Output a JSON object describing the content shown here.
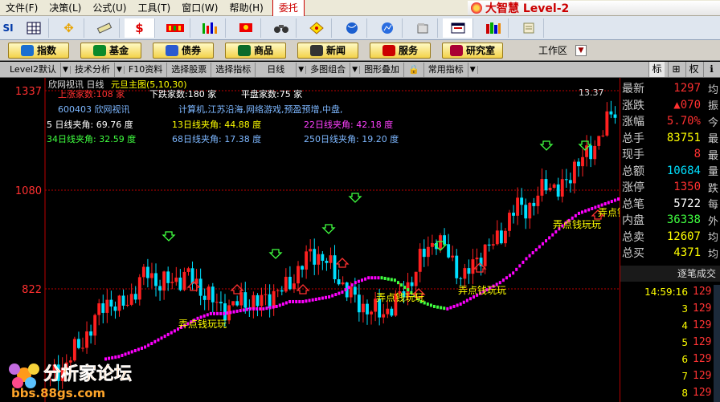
{
  "menu": {
    "items": [
      "文件(F)",
      "决策(L)",
      "公式(U)",
      "工具(T)",
      "窗口(W)",
      "帮助(H)"
    ],
    "weituo": "委托",
    "brand": "大智慧 Level-2"
  },
  "iconbar": {
    "icons": [
      "si-icon",
      "grid-icon",
      "move-icon",
      "ruler-icon",
      "dollar-icon",
      "stripes-icon",
      "bars-icon",
      "flag-icon",
      "binoculars-icon",
      "diamond-icon",
      "globe-icon",
      "chart-icon",
      "doc-icon",
      "window-icon",
      "books-icon",
      "scroll-icon"
    ]
  },
  "funcbar": {
    "buttons": [
      "指数",
      "基金",
      "债券",
      "商品",
      "新闻",
      "服务",
      "研究室"
    ],
    "workspace": "工作区"
  },
  "tabs": {
    "items": [
      "Level2默认",
      "技术分析",
      "F10资料",
      "选择股票",
      "选择指标",
      "日线",
      "多图组合",
      "图形叠加",
      "常用指标"
    ],
    "right": [
      "标",
      "⊞",
      "权",
      "ℹ"
    ]
  },
  "chart": {
    "title": "欣网视讯 日线",
    "subtitle": "元旦主图(5,10,30)",
    "up_text": "上涨家数:108 家",
    "down_text": "下跌家数:180 家",
    "flat_text": "平盘家数:75 家",
    "code_name": "600403 欣网视讯",
    "concepts": "计算机,江苏沿海,网络游戏,预盈预增,中盘,",
    "angle_lines": [
      [
        "5 日线夹角: 69.76 度",
        "13日线夹角: 44.88 度",
        "22日线夹角: 42.18 度"
      ],
      [
        "34日线夹角: 32.59 度",
        "68日线夹角: 17.38 度",
        "250日线夹角: 19.20 度"
      ]
    ],
    "high_label": "13.37",
    "y_labels": [
      "1337",
      "1080",
      "822"
    ],
    "annotations": [
      "弄点钱玩玩",
      "弄点钱玩玩",
      "弄点钱玩玩",
      "弄点钱玩玩",
      "弄点钱玩"
    ],
    "watermark": "分析家论坛",
    "watermark_url": "bbs.88gs.com",
    "colors": {
      "up": "#ff2020",
      "down": "#00e0ff",
      "ma_low": "#ff00ff",
      "ma_high": "#40ff40"
    }
  },
  "chart_data": {
    "type": "candlestick",
    "ylim": [
      700,
      1337
    ],
    "ma_levels": [
      775,
      780,
      790,
      800,
      815,
      830,
      845,
      860,
      870,
      870,
      875,
      880,
      880,
      885,
      895,
      895,
      900,
      905,
      915,
      935,
      945,
      945,
      940,
      920,
      895,
      885,
      880,
      890,
      905,
      920,
      935,
      955,
      985,
      1010,
      1035,
      1060,
      1080,
      1090,
      1100,
      1110
    ],
    "closes": [
      740,
      760,
      800,
      840,
      900,
      880,
      910,
      960,
      930,
      940,
      950,
      920,
      890,
      880,
      900,
      890,
      910,
      920,
      960,
      1000,
      980,
      940,
      900,
      880,
      870,
      890,
      930,
      990,
      1030,
      990,
      940,
      990,
      1010,
      1050,
      1100,
      1090,
      1150,
      1120,
      1180,
      1200,
      1250,
      1297
    ]
  },
  "quote": {
    "rows": [
      {
        "label": "最新",
        "value": "1297",
        "suffix": "均",
        "color": "#ff3030"
      },
      {
        "label": "涨跌",
        "value": "▲070",
        "suffix": "振",
        "color": "#ff3030"
      },
      {
        "label": "涨幅",
        "value": "5.70%",
        "suffix": "今",
        "color": "#ff3030"
      },
      {
        "label": "总手",
        "value": "83751",
        "suffix": "最",
        "color": "#ffff00"
      },
      {
        "label": "现手",
        "value": "8",
        "suffix": "最",
        "color": "#ff3030"
      },
      {
        "label": "总额",
        "value": "10684",
        "suffix": "量",
        "color": "#00e0ff"
      },
      {
        "label": "涨停",
        "value": "1350",
        "suffix": "跌",
        "color": "#ff3030"
      },
      {
        "label": "总笔",
        "value": "5722",
        "suffix": "每",
        "color": "#ffffff"
      },
      {
        "label": "内盘",
        "value": "36338",
        "suffix": "外",
        "color": "#40ff40"
      },
      {
        "label": "总卖",
        "value": "12607",
        "suffix": "均",
        "color": "#ffff00"
      },
      {
        "label": "总买",
        "value": "4371",
        "suffix": "均",
        "color": "#ffff00"
      }
    ],
    "tick_header": "逐笔成交",
    "ticks": [
      {
        "t": "14:59:16",
        "p": "129"
      },
      {
        "t": "3",
        "p": "129"
      },
      {
        "t": "4",
        "p": "129"
      },
      {
        "t": "5",
        "p": "129"
      },
      {
        "t": "6",
        "p": "129"
      },
      {
        "t": "7",
        "p": "129"
      },
      {
        "t": "8",
        "p": "129"
      }
    ]
  }
}
